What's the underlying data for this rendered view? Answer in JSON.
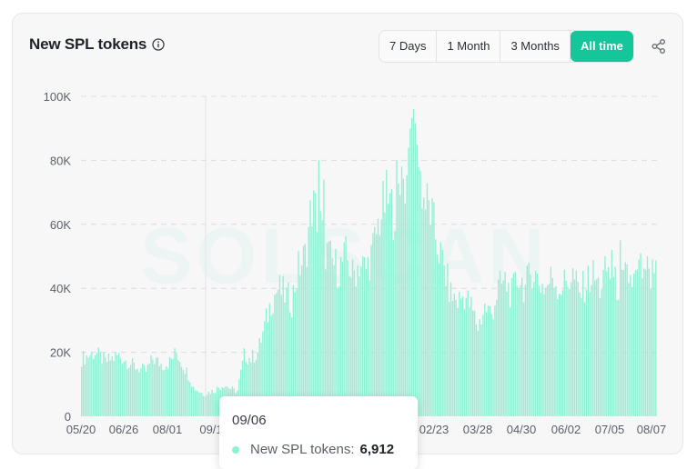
{
  "header": {
    "title": "New SPL tokens",
    "info_icon": "info-circle-icon",
    "share_icon": "share-icon"
  },
  "tabs": [
    {
      "label": "7 Days",
      "active": false
    },
    {
      "label": "1 Month",
      "active": false
    },
    {
      "label": "3 Months",
      "active": false
    },
    {
      "label": "All time",
      "active": true
    }
  ],
  "watermark": "SOLSCAN",
  "colors": {
    "accent": "#14c69a",
    "bar": "#8ff0d3"
  },
  "tooltip": {
    "date": "09/06",
    "series_label": "New SPL tokens:",
    "value": "6,912"
  },
  "chart_data": {
    "type": "bar",
    "title": "New SPL tokens",
    "ylim": [
      0,
      100000
    ],
    "yticks": [
      "0",
      "20K",
      "40K",
      "60K",
      "80K",
      "100K"
    ],
    "xticks": [
      "05/20",
      "06/26",
      "08/01",
      "09/1",
      "02/23",
      "03/28",
      "04/30",
      "06/02",
      "07/05",
      "08/07"
    ],
    "grid": true,
    "series": [
      {
        "name": "New SPL tokens",
        "anchors": [
          [
            0,
            18000
          ],
          [
            8,
            20000
          ],
          [
            14,
            17000
          ],
          [
            22,
            19000
          ],
          [
            30,
            16000
          ],
          [
            38,
            14000
          ],
          [
            42,
            18000
          ],
          [
            48,
            16000
          ],
          [
            52,
            17000
          ],
          [
            56,
            20000
          ],
          [
            60,
            16000
          ],
          [
            64,
            12000
          ],
          [
            66,
            9000
          ],
          [
            72,
            7000
          ],
          [
            78,
            8000
          ],
          [
            84,
            10000
          ],
          [
            90,
            8000
          ],
          [
            92,
            8000
          ],
          [
            96,
            19000
          ],
          [
            100,
            18000
          ],
          [
            104,
            20000
          ],
          [
            108,
            28000
          ],
          [
            112,
            36000
          ],
          [
            116,
            40000
          ],
          [
            120,
            38000
          ],
          [
            124,
            36000
          ],
          [
            128,
            46000
          ],
          [
            132,
            50000
          ],
          [
            136,
            66000
          ],
          [
            140,
            62000
          ],
          [
            144,
            52000
          ],
          [
            148,
            48000
          ],
          [
            152,
            46000
          ],
          [
            156,
            50000
          ],
          [
            160,
            44000
          ],
          [
            164,
            48000
          ],
          [
            168,
            46000
          ],
          [
            172,
            52000
          ],
          [
            176,
            62000
          ],
          [
            180,
            68000
          ],
          [
            184,
            64000
          ],
          [
            188,
            70000
          ],
          [
            192,
            74000
          ],
          [
            195,
            90000
          ],
          [
            198,
            82000
          ],
          [
            202,
            68000
          ],
          [
            206,
            64000
          ],
          [
            210,
            54000
          ],
          [
            214,
            46000
          ],
          [
            218,
            38000
          ],
          [
            222,
            36000
          ],
          [
            226,
            38000
          ],
          [
            230,
            34000
          ],
          [
            234,
            28000
          ],
          [
            238,
            34000
          ],
          [
            242,
            32000
          ],
          [
            246,
            40000
          ],
          [
            250,
            42000
          ],
          [
            254,
            38000
          ],
          [
            258,
            44000
          ],
          [
            262,
            40000
          ],
          [
            266,
            46000
          ],
          [
            270,
            42000
          ],
          [
            274,
            40000
          ],
          [
            278,
            44000
          ],
          [
            282,
            40000
          ],
          [
            286,
            42000
          ],
          [
            290,
            44000
          ],
          [
            294,
            38000
          ],
          [
            298,
            42000
          ],
          [
            302,
            44000
          ],
          [
            306,
            40000
          ],
          [
            310,
            46000
          ],
          [
            314,
            42000
          ],
          [
            318,
            40000
          ],
          [
            322,
            44000
          ],
          [
            326,
            42000
          ],
          [
            330,
            46000
          ],
          [
            334,
            40000
          ],
          [
            338,
            44000
          ]
        ],
        "peaks": [
          [
            196,
            96000
          ],
          [
            194,
            90000
          ],
          [
            198,
            85000
          ],
          [
            193,
            84000
          ],
          [
            186,
            80000
          ],
          [
            189,
            78000
          ],
          [
            140,
            80000
          ],
          [
            143,
            74000
          ],
          [
            318,
            55000
          ],
          [
            313,
            52000
          ],
          [
            334,
            50000
          ],
          [
            337,
            49000
          ]
        ],
        "count": 340
      }
    ]
  }
}
